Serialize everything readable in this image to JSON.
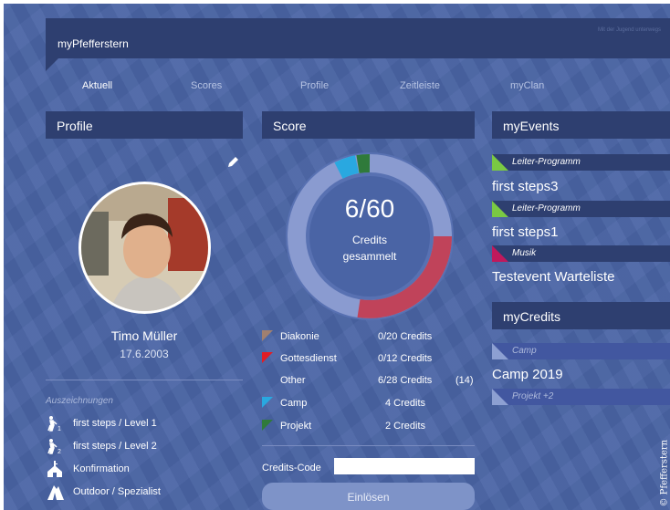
{
  "app": {
    "title": "myPfefferstern",
    "header_fineprint": "Mit der Jugend unterwegs"
  },
  "nav": {
    "items": [
      "Aktuell",
      "Scores",
      "Profile",
      "Zeitleiste",
      "myClan"
    ],
    "active": "Aktuell"
  },
  "profile": {
    "heading": "Profile",
    "name": "Timo Müller",
    "dob": "17.6.2003",
    "awards_title": "Auszeichnungen",
    "awards": [
      {
        "label": "first steps / Level 1",
        "icon": "hiker-level1-icon"
      },
      {
        "label": "first steps / Level 2",
        "icon": "hiker-level2-icon"
      },
      {
        "label": "Konfirmation",
        "icon": "church-icon"
      },
      {
        "label": "Outdoor / Spezialist",
        "icon": "tent-icon"
      }
    ]
  },
  "score": {
    "heading": "Score",
    "total": "6/60",
    "line1": "Credits",
    "line2": "gesammelt",
    "categories": [
      {
        "name": "Diakonie",
        "value": "0/20 Credits",
        "extra": "",
        "color": "#a08070"
      },
      {
        "name": "Gottesdienst",
        "value": "0/12 Credits",
        "extra": "",
        "color": "#e31c24"
      },
      {
        "name": "Other",
        "value": "6/28 Credits",
        "extra": "(14)",
        "color": ""
      },
      {
        "name": "Camp",
        "value": "4 Credits",
        "extra": "",
        "color": "#29a8e0"
      },
      {
        "name": "Projekt",
        "value": "2 Credits",
        "extra": "",
        "color": "#2f7a3a"
      }
    ],
    "code_label": "Credits-Code",
    "code_value": "",
    "redeem_label": "Einlösen"
  },
  "events": {
    "heading": "myEvents",
    "items": [
      {
        "category": "Leiter-Programm",
        "title": "first steps3",
        "color": "#7ac943"
      },
      {
        "category": "Leiter-Programm",
        "title": "first steps1",
        "color": "#7ac943"
      },
      {
        "category": "Musik",
        "title": "Testevent Warteliste",
        "color": "#c0195c"
      }
    ]
  },
  "credits": {
    "heading": "myCredits",
    "items": [
      {
        "category": "Camp",
        "title": "Camp 2019"
      },
      {
        "category": "Projekt +2",
        "title": ""
      }
    ]
  },
  "watermark": "© Pfefferstern",
  "colors": {
    "panel_dark": "#2e3f70",
    "background": "#4a64a5",
    "ring_track": "#8a9bd0",
    "ring_red": "#c0435a",
    "ring_blue": "#29a8e0",
    "ring_green": "#2f7a3a"
  }
}
